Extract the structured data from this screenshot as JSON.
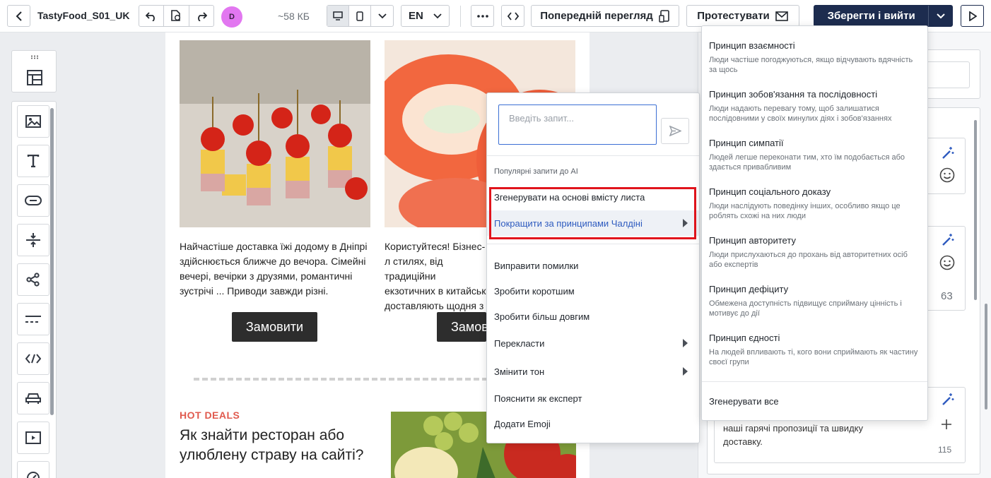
{
  "toolbar": {
    "project_name": "TastyFood_S01_UK",
    "avatar_initial": "D",
    "size": "~58 КБ",
    "language": "EN",
    "preview_label": "Попередній перегляд",
    "test_label": "Протестувати",
    "save_label": "Зберегти і вийти"
  },
  "email": {
    "card1_text": "Найчастіше доставка їжі додому в Дніпрі здійснюється ближче до вечора. Сімейні вечері, вечірки з друзями, романтичні зустрічі ... Приводи завжди різні.",
    "card2_text": "Користуйтеся! Бізнес-л стилях, від традиційни екзотичних в китайськ доставляють щодня з",
    "order_label": "Замовити",
    "order_label_2": "Замов",
    "hot_deals": "HOT DEALS",
    "hot_title": "Як знайти ресторан або улюблену страву на сайті?"
  },
  "right_panel": {
    "count_1": "63",
    "count_2": "115",
    "text": "наші гарячі пропозиції та швидку доставку."
  },
  "ai_popup": {
    "input_placeholder": "Введіть запит...",
    "section_label": "Популярні запити до AI",
    "items": [
      {
        "label": "Згенерувати на основі вмісту листа"
      },
      {
        "label": "Покращити за принципами Чалдіні"
      },
      {
        "label": "Виправити помилки"
      },
      {
        "label": "Зробити коротшим"
      },
      {
        "label": "Зробити більш довгим"
      },
      {
        "label": "Перекласти"
      },
      {
        "label": "Змінити тон"
      },
      {
        "label": "Пояснити як експерт"
      },
      {
        "label": "Додати Emoji"
      }
    ]
  },
  "submenu": {
    "principles": [
      {
        "title": "Принцип взаємності",
        "desc": "Люди частіше погоджуються, якщо відчувають вдячність за щось"
      },
      {
        "title": "Принцип зобов'язання та послідовності",
        "desc": "Люди надають перевагу тому, щоб залишатися послідовними у своїх минулих діях і зобов'язаннях"
      },
      {
        "title": "Принцип симпатії",
        "desc": "Людей легше переконати тим, хто їм подобається або здається привабливим"
      },
      {
        "title": "Принцип соціального доказу",
        "desc": "Люди наслідують поведінку інших, особливо якщо це роблять схожі на них люди"
      },
      {
        "title": "Принцип авторитету",
        "desc": "Люди прислухаються до прохань від авторитетних осіб або експертів"
      },
      {
        "title": "Принцип дефіциту",
        "desc": "Обмежена доступність підвищує сприйману цінність і мотивує до дії"
      },
      {
        "title": "Принцип єдності",
        "desc": "На людей впливають ті, кого вони сприймають як частину своєї групи"
      }
    ],
    "generate_all": "Згенерувати все"
  },
  "colors": {
    "accent": "#1d2c4f",
    "highlight": "#e1141c",
    "link": "#2e5bbf",
    "hot_deals": "#e05a4e"
  }
}
